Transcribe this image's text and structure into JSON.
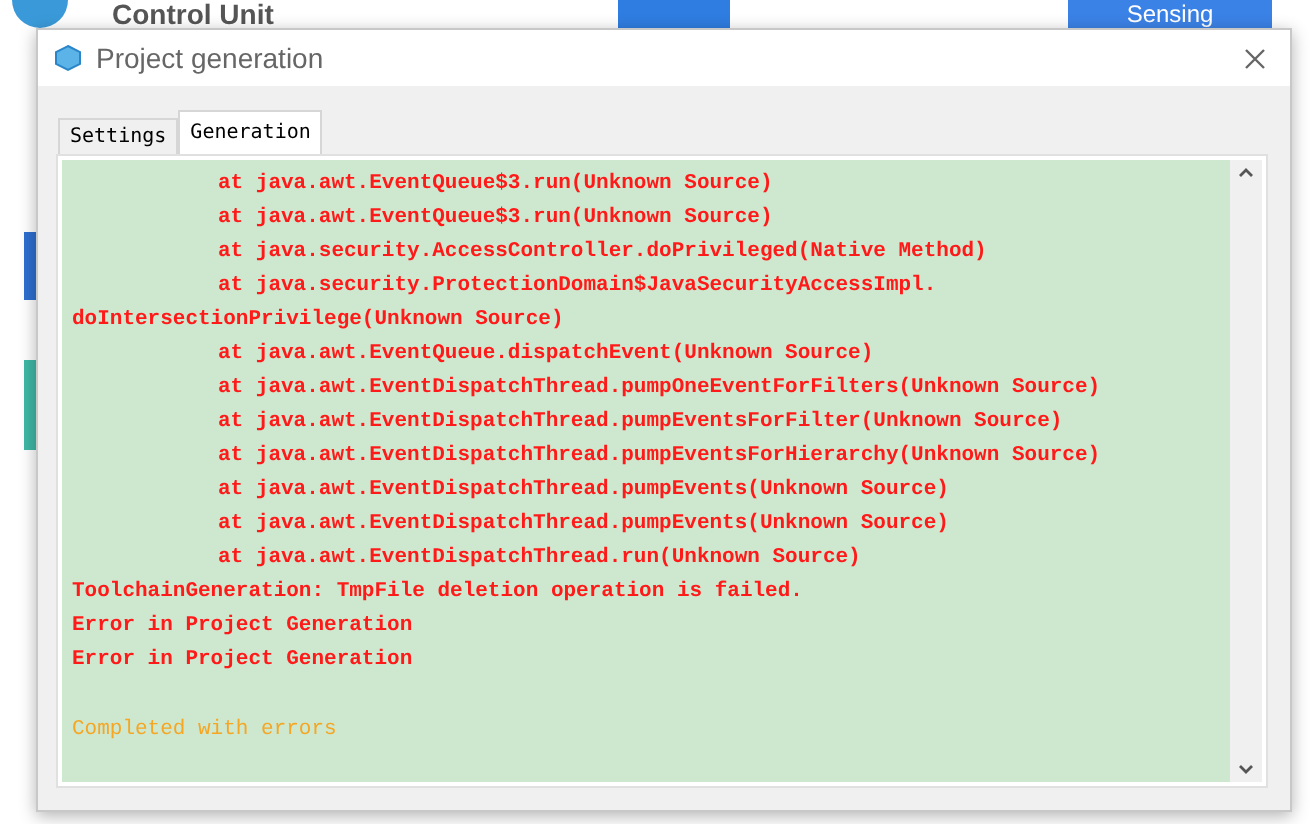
{
  "background_app": {
    "title": "Control Unit",
    "node_label": "Sensing"
  },
  "dialog": {
    "title": "Project generation",
    "tabs": [
      {
        "label": "Settings",
        "selected": false
      },
      {
        "label": "Generation",
        "selected": true
      }
    ],
    "log": [
      {
        "kind": "trace",
        "text": "at java.awt.EventQueue$3.run(Unknown Source)"
      },
      {
        "kind": "trace",
        "text": "at java.awt.EventQueue$3.run(Unknown Source)"
      },
      {
        "kind": "trace",
        "text": "at java.security.AccessController.doPrivileged(Native Method)"
      },
      {
        "kind": "trace",
        "text": "at java.security.ProtectionDomain$JavaSecurityAccessImpl."
      },
      {
        "kind": "plain",
        "text": "doIntersectionPrivilege(Unknown Source)"
      },
      {
        "kind": "trace",
        "text": "at java.awt.EventQueue.dispatchEvent(Unknown Source)"
      },
      {
        "kind": "trace",
        "text": "at java.awt.EventDispatchThread.pumpOneEventForFilters(Unknown Source)"
      },
      {
        "kind": "trace",
        "text": "at java.awt.EventDispatchThread.pumpEventsForFilter(Unknown Source)"
      },
      {
        "kind": "trace",
        "text": "at java.awt.EventDispatchThread.pumpEventsForHierarchy(Unknown Source)"
      },
      {
        "kind": "trace",
        "text": "at java.awt.EventDispatchThread.pumpEvents(Unknown Source)"
      },
      {
        "kind": "trace",
        "text": "at java.awt.EventDispatchThread.pumpEvents(Unknown Source)"
      },
      {
        "kind": "trace",
        "text": "at java.awt.EventDispatchThread.run(Unknown Source)"
      },
      {
        "kind": "plain",
        "text": "ToolchainGeneration: TmpFile deletion operation is failed."
      },
      {
        "kind": "plain",
        "text": "Error in Project Generation"
      },
      {
        "kind": "plain",
        "text": "Error in Project Generation"
      },
      {
        "kind": "status",
        "text": "Completed with errors"
      }
    ]
  }
}
